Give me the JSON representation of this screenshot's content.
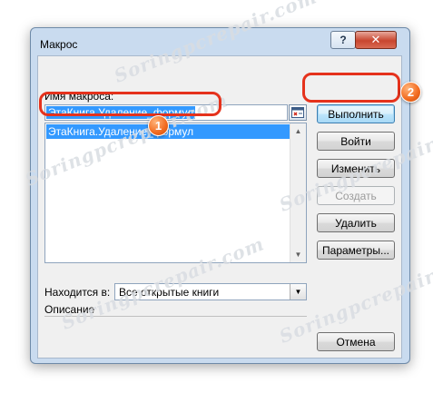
{
  "watermark": "Soringpcrepair.com",
  "dialog": {
    "title": "Макрос",
    "help_label": "?",
    "close_label": "✕"
  },
  "macro_name": {
    "label": "Имя макроса:",
    "value": "ЭтаКнига.Удаление_формул"
  },
  "macro_list": {
    "items": [
      {
        "label": "ЭтаКнига.Удаление_формул",
        "selected": true
      }
    ]
  },
  "buttons": {
    "run": "Выполнить",
    "step_into": "Войти",
    "edit": "Изменить",
    "create": "Создать",
    "delete": "Удалить",
    "options": "Параметры...",
    "cancel": "Отмена"
  },
  "macros_in": {
    "label": "Находится в:",
    "value": "Все открытые книги"
  },
  "description": {
    "label": "Описание"
  },
  "annotations": {
    "badge_1": "1",
    "badge_2": "2",
    "accent": "#e5321c"
  }
}
